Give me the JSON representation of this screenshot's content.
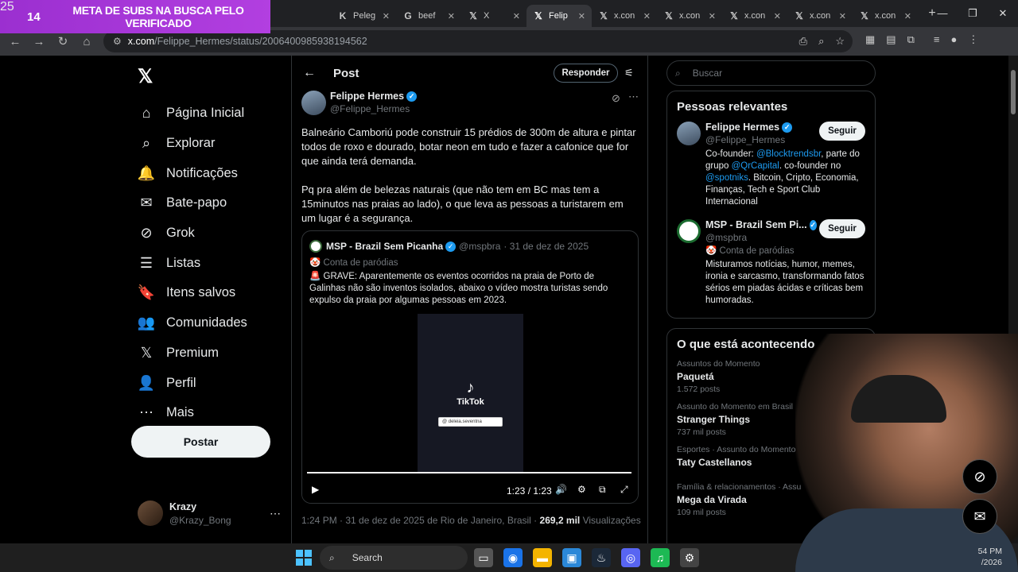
{
  "overlay": {
    "num": "14",
    "text": "META DE SUBS NA BUSCA PELO VERIFICADO",
    "num2": "25"
  },
  "tabs": [
    {
      "label": "Peleg",
      "icon": "K"
    },
    {
      "label": "beef",
      "icon": "G"
    },
    {
      "label": "X",
      "icon": "𝕏"
    },
    {
      "label": "Felip",
      "icon": "𝕏"
    },
    {
      "label": "x.con",
      "icon": "𝕏"
    },
    {
      "label": "x.con",
      "icon": "𝕏"
    },
    {
      "label": "x.con",
      "icon": "𝕏"
    },
    {
      "label": "x.con",
      "icon": "𝕏"
    },
    {
      "label": "x.con",
      "icon": "𝕏"
    }
  ],
  "address": {
    "host": "x.com",
    "path": "/Felippe_Hermes/status/2006400985938194562"
  },
  "nav": {
    "items": [
      {
        "label": "Página Inicial",
        "icon": "⌂"
      },
      {
        "label": "Explorar",
        "icon": "⌕"
      },
      {
        "label": "Notificações",
        "icon": "🔔"
      },
      {
        "label": "Bate-papo",
        "icon": "✉"
      },
      {
        "label": "Grok",
        "icon": "⊘"
      },
      {
        "label": "Listas",
        "icon": "☰"
      },
      {
        "label": "Itens salvos",
        "icon": "🔖"
      },
      {
        "label": "Comunidades",
        "icon": "👥"
      },
      {
        "label": "Premium",
        "icon": "𝕏"
      },
      {
        "label": "Perfil",
        "icon": "👤"
      },
      {
        "label": "Mais",
        "icon": "⋯"
      }
    ],
    "post_label": "Postar",
    "account": {
      "name": "Krazy",
      "handle": "@Krazy_Bong"
    }
  },
  "feed": {
    "title": "Post",
    "reply_label": "Responder",
    "author": {
      "name": "Felippe Hermes",
      "handle": "@Felippe_Hermes"
    },
    "paragraphs": [
      "Balneário Camboriú pode construir 15 prédios de 300m de altura e pintar todos de roxo e dourado, botar neon em tudo e fazer a cafonice que for que ainda terá demanda.",
      "Pq pra além de belezas naturais (que não tem em BC mas tem a 15minutos nas praias ao lado), o que leva as pessoas a turistarem em um lugar é a segurança."
    ],
    "quote": {
      "name": "MSP - Brazil Sem Picanha",
      "handle": "@mspbra",
      "date": "· 31 de dez de 2025",
      "sub": "🤡 Conta de paródias",
      "text": "🚨 GRAVE: Aparentemente os eventos ocorridos na praia de Porto de Galinhas não são inventos isolados, abaixo o vídeo mostra turistas sendo expulso da praia por algumas pessoas em 2023.",
      "video": {
        "brand": "TikTok",
        "search": "@ deleia.seventna",
        "time": "1:23 / 1:23",
        "progress": 1.0
      }
    },
    "stamp": {
      "time": "1:24 PM · 31 de dez de 2025 de Rio de Janeiro, Brasil ·",
      "views": "269,2 mil",
      "views_label": "Visualizações"
    }
  },
  "right": {
    "search_placeholder": "Buscar",
    "people_title": "Pessoas relevantes",
    "people": [
      {
        "name": "Felippe Hermes",
        "handle": "@Felippe_Hermes",
        "follow": "Seguir",
        "bio_a": "Co-founder: ",
        "link1": "@Blocktrendsbr",
        "bio_b": ", parte do grupo ",
        "link2": "@QrCapital",
        "bio_c": ". co-founder no ",
        "link3": "@spotniks",
        "bio_d": ". Bitcoin, Cripto, Economia, Finanças, Tech e Sport Club Internacional"
      },
      {
        "name": "MSP - Brazil Sem Pi...",
        "handle": "@mspbra",
        "follow": "Seguir",
        "sub": "🤡 Conta de paródias",
        "bio": "Misturamos notícias, humor, memes, ironia e sarcasmo, transformando fatos sérios em piadas ácidas e críticas bem humoradas."
      }
    ],
    "trends_title": "O que está acontecendo",
    "trends": [
      {
        "cat": "Assuntos do Momento",
        "name": "Paquetá",
        "count": "1.572 posts"
      },
      {
        "cat": "Assunto do Momento em Brasil",
        "name": "Stranger Things",
        "count": "737 mil posts"
      },
      {
        "cat": "Esportes · Assunto do Momento",
        "name": "Taty Castellanos",
        "count": ""
      },
      {
        "cat": "Família & relacionamentos · Assu",
        "name": "Mega da Virada",
        "count": "109 mil posts"
      }
    ]
  },
  "taskbar": {
    "search": "Search",
    "clock_time": "54 PM",
    "clock_date": "/2026"
  }
}
